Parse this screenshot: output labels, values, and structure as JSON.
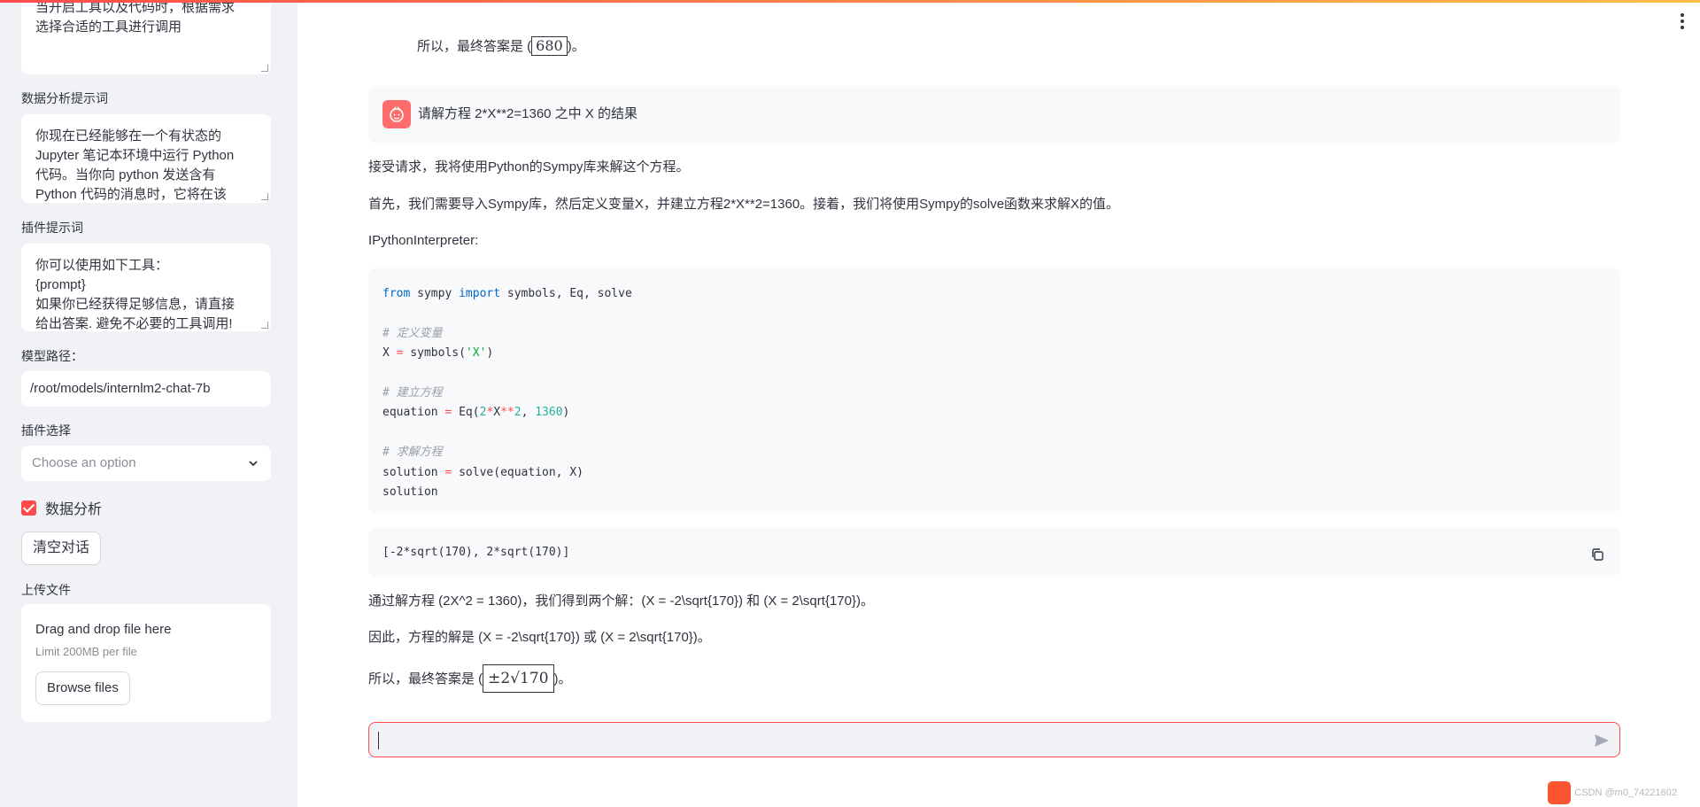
{
  "sidebar": {
    "tool_prompt_lines": [
      "当开启工具以及代码时，根据需求",
      "选择合适的工具进行调用"
    ],
    "data_analysis": {
      "label": "数据分析提示词",
      "lines": [
        "你现在已经能够在一个有状态的",
        "Jupyter 笔记本环境中运行 Python",
        "代码。当你向 python 发送含有",
        "Python 代码的消息时，它将在该"
      ]
    },
    "plugin_prompt": {
      "label": "插件提示词",
      "lines": [
        "你可以使用如下工具：",
        "{prompt}",
        "如果你已经获得足够信息，请直接",
        "给出答案. 避免不必要的工具调用!"
      ]
    },
    "model_path": {
      "label": "模型路径：",
      "value": "/root/models/internlm2-chat-7b"
    },
    "plugin_select": {
      "label": "插件选择",
      "placeholder": "Choose an option"
    },
    "data_analysis_checkbox": "数据分析",
    "clear_button": "清空对话",
    "upload": {
      "label": "上传文件",
      "title": "Drag and drop file here",
      "subtitle": "Limit 200MB per file",
      "browse": "Browse files"
    }
  },
  "chat": {
    "prev_answer_prefix": "所以，最终答案是 (",
    "prev_answer_value": "680",
    "prev_answer_suffix": ")。",
    "user_message": "请解方程 2*X**2=1360 之中 X 的结果",
    "reply_1": "接受请求，我将使用Python的Sympy库来解这个方程。",
    "reply_2": "首先，我们需要导入Sympy库，然后定义变量X，并建立方程2*X**2=1360。接着，我们将使用Sympy的solve函数来求解X的值。",
    "interpreter_label": "IPythonInterpreter:",
    "code": {
      "l1_from": "from",
      "l1_mid": " sympy ",
      "l1_import": "import",
      "l1_rest": " symbols, Eq, solve",
      "l3": "# 定义变量",
      "l4_a": "X ",
      "l4_op": "=",
      "l4_b": " symbols(",
      "l4_str": "'X'",
      "l4_c": ")",
      "l6": "# 建立方程",
      "l7_a": "equation ",
      "l7_op": "=",
      "l7_b": " Eq(",
      "l7_n1": "2",
      "l7_op2": "*",
      "l7_c": "X",
      "l7_op3": "**",
      "l7_n2": "2",
      "l7_d": ", ",
      "l7_n3": "1360",
      "l7_e": ")",
      "l9": "# 求解方程",
      "l10_a": "solution ",
      "l10_op": "=",
      "l10_b": " solve(equation, X)",
      "l11": "solution"
    },
    "output": "[-2*sqrt(170), 2*sqrt(170)]",
    "result_1": "通过解方程 (2X^2 = 1360)，我们得到两个解：(X = -2\\sqrt{170}) 和 (X = 2\\sqrt{170})。",
    "result_2": "因此，方程的解是 (X = -2\\sqrt{170}) 或 (X = 2\\sqrt{170})。",
    "final_prefix": "所以，最终答案是 (",
    "final_value": "±2√170",
    "final_suffix": ")。"
  },
  "watermark": "CSDN @m0_74221602",
  "accent_color": "#ff4b4b"
}
